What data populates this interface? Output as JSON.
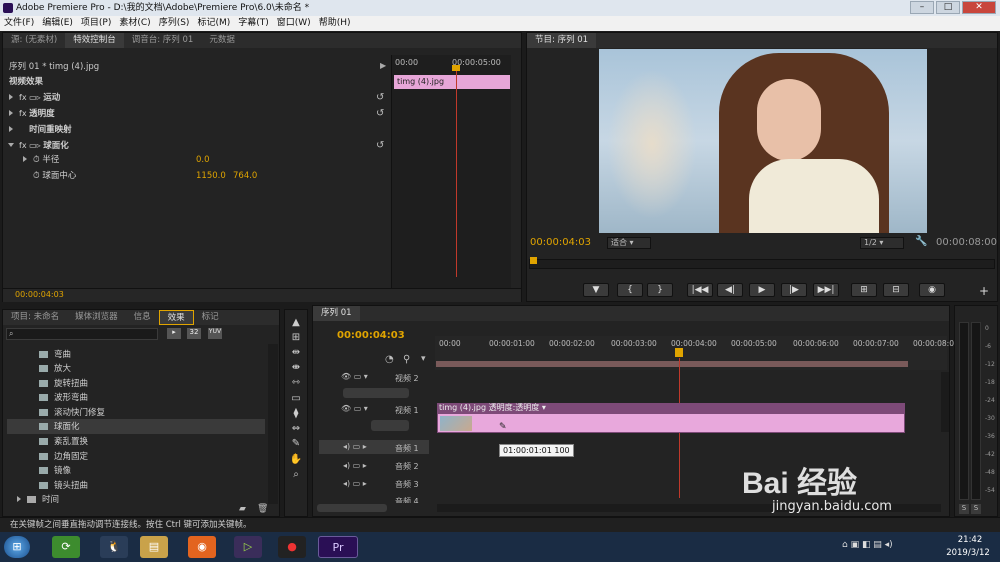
{
  "window": {
    "title": "Adobe Premiere Pro - D:\\我的文档\\Adobe\\Premiere Pro\\6.0\\未命名 *"
  },
  "menu": [
    "文件(F)",
    "编辑(E)",
    "项目(P)",
    "素材(C)",
    "序列(S)",
    "标记(M)",
    "字幕(T)",
    "窗口(W)",
    "帮助(H)"
  ],
  "source_panel": {
    "tabs": [
      "源: (无素材)",
      "特效控制台",
      "调音台: 序列 01",
      "元数据"
    ],
    "clip_label": "序列 01 * timg (4).jpg",
    "ruler_start": "00:00",
    "ruler_mid": "00:00:05:00",
    "mini_clip": "timg (4).jpg",
    "video_effects_header": "视频效果",
    "effects": [
      "运动",
      "透明度",
      "时间重映射",
      "球面化"
    ],
    "params": [
      {
        "name": "半径",
        "value": "0.0"
      },
      {
        "name": "球面中心",
        "value": "1150.0",
        "value2": "764.0"
      }
    ],
    "timecode": "00:00:04:03"
  },
  "program_panel": {
    "tab": "节目: 序列 01",
    "timecode": "00:00:04:03",
    "fit": "适合",
    "quality": "1/2",
    "duration": "00:00:08:00",
    "transport": [
      "▼",
      "{",
      "}",
      "|◀◀",
      "◀|",
      "▶",
      "|▶",
      "▶▶|",
      "⊞",
      "⊟",
      "◉"
    ],
    "add": "+"
  },
  "project_panel": {
    "tabs": [
      "项目: 未命名",
      "媒体浏览器",
      "信息",
      "效果",
      "标记"
    ],
    "badges": [
      "32",
      "YUV"
    ],
    "items": [
      "弯曲",
      "放大",
      "旋转扭曲",
      "波形弯曲",
      "滚动快门修复",
      "球面化",
      "紊乱置换",
      "边角固定",
      "镜像",
      "镜头扭曲"
    ],
    "folder": "时间",
    "selected_index": 5
  },
  "tools": [
    "▲",
    "⊞",
    "⇹",
    "⇼",
    "⇿",
    "▭",
    "⧫",
    "⇔",
    "✎",
    "✋",
    "⌕"
  ],
  "timeline": {
    "tab": "序列 01",
    "timecode": "00:00:04:03",
    "ruler": [
      "00:00",
      "00:00:01:00",
      "00:00:02:00",
      "00:00:03:00",
      "00:00:04:00",
      "00:00:05:00",
      "00:00:06:00",
      "00:00:07:00",
      "00:00:08:00"
    ],
    "tracks": {
      "video2": "视频 2",
      "video1": "视频 1",
      "audio1": "音频 1",
      "audio2": "音频 2",
      "audio3": "音频 3",
      "audio4": "音频 4"
    },
    "clip_label": "timg (4).jpg",
    "clip_effect": "透明度:透明度 ▾",
    "tooltip": "01:00:01:01  100"
  },
  "audio_meter": {
    "scale": [
      "0",
      "-6",
      "-12",
      "-18",
      "-24",
      "-30",
      "-36",
      "-42",
      "-48",
      "-54"
    ],
    "solo": [
      "S",
      "S"
    ]
  },
  "status_bar": {
    "text": "在关键帧之间垂直拖动调节连接线。按住 Ctrl 键可添加关键帧。"
  },
  "taskbar": {
    "time": "21:42",
    "date": "2019/3/12",
    "tray": "⌂ ▣ ◧ ▤ ◂)"
  },
  "watermark": {
    "brand": "Bai 经验",
    "url": "jingyan.baidu.com"
  }
}
